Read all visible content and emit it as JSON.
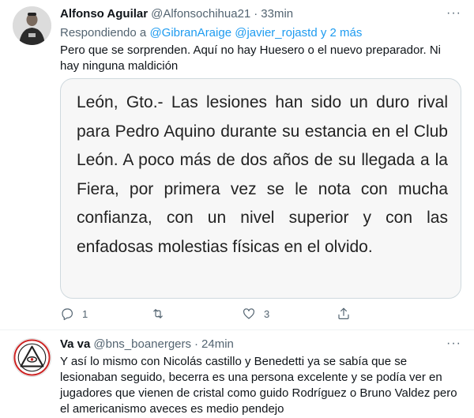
{
  "tweet1": {
    "name": "Alfonso Aguilar",
    "handle": "@Alfonsochihua21",
    "separator": "·",
    "time": "33min",
    "more": "···",
    "replying_prefix": "Respondiendo a",
    "mention1": "@GibranAraige",
    "mention2": "@javier_rojastd",
    "replying_suffix": "y 2 más",
    "text": "Pero que se sorprenden. Aquí no hay Huesero o el nuevo preparador. Ni hay ninguna maldición",
    "quote_text": "León, Gto.- Las lesiones han sido un duro rival para Pedro Aquino durante su estancia en el Club León. A poco más de dos años de su llegada a la Fiera, por primera vez se le nota con mucha confianza, con un nivel superior y con las enfadosas molestias físicas en el olvido.",
    "actions": {
      "reply_count": "1",
      "retweet_count": "",
      "like_count": "3",
      "share_count": ""
    }
  },
  "tweet2": {
    "name": "Va va",
    "handle": "@bns_boanergers",
    "separator": "·",
    "time": "24min",
    "more": "···",
    "text": "Y así lo mismo con Nicolás castillo y Benedetti ya se sabía que se lesionaban seguido, becerra es una persona excelente y se podía ver en jugadores que vienen de cristal como guido Rodríguez o Bruno Valdez pero el americanismo aveces es medio pendejo"
  },
  "colors": {
    "text": "#0f1419",
    "secondary": "#536471",
    "accent": "#1d9bf0",
    "border": "#cfd9de",
    "quote_bg": "#f7f7f7"
  }
}
